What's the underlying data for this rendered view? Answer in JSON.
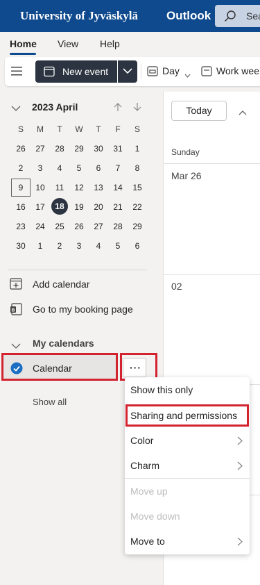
{
  "header": {
    "brand": "University of Jyväskylä",
    "app_name": "Outlook",
    "search_text": "Sea"
  },
  "ribbon": {
    "tabs": [
      {
        "label": "Home",
        "active": true
      },
      {
        "label": "View",
        "active": false
      },
      {
        "label": "Help",
        "active": false
      }
    ]
  },
  "commandbar": {
    "new_event": "New event",
    "day": "Day",
    "work_week": "Work wee"
  },
  "minical": {
    "title": "2023 April",
    "weekdays": [
      "S",
      "M",
      "T",
      "W",
      "T",
      "F",
      "S"
    ],
    "weeks": [
      [
        "26",
        "27",
        "28",
        "29",
        "30",
        "31",
        "1"
      ],
      [
        "2",
        "3",
        "4",
        "5",
        "6",
        "7",
        "8"
      ],
      [
        "9",
        "10",
        "11",
        "12",
        "13",
        "14",
        "15"
      ],
      [
        "16",
        "17",
        "18",
        "19",
        "20",
        "21",
        "22"
      ],
      [
        "23",
        "24",
        "25",
        "26",
        "27",
        "28",
        "29"
      ],
      [
        "30",
        "1",
        "2",
        "3",
        "4",
        "5",
        "6"
      ]
    ],
    "today": "18",
    "selected": "9"
  },
  "sidebar": {
    "add_calendar": "Add calendar",
    "booking_page": "Go to my booking page",
    "my_calendars": "My calendars",
    "calendar_name": "Calendar",
    "more_dots": "···",
    "show_all": "Show all"
  },
  "calendar_view": {
    "today_button": "Today",
    "day_header": "Sunday",
    "date1": "Mar 26",
    "date2": "02"
  },
  "context_menu": {
    "items": [
      {
        "label": "Show this only",
        "disabled": false,
        "submenu": false
      },
      {
        "label": "Sharing and permissions",
        "disabled": false,
        "submenu": false
      },
      {
        "label": "Color",
        "disabled": false,
        "submenu": true
      },
      {
        "label": "Charm",
        "disabled": false,
        "submenu": true
      },
      {
        "label": "Move up",
        "disabled": true,
        "submenu": false
      },
      {
        "label": "Move down",
        "disabled": true,
        "submenu": false
      },
      {
        "label": "Move to",
        "disabled": false,
        "submenu": true
      }
    ]
  },
  "colors": {
    "header_bg": "#0f4a8f",
    "highlight_red": "#d3232f",
    "primary_dark": "#2b3440"
  }
}
